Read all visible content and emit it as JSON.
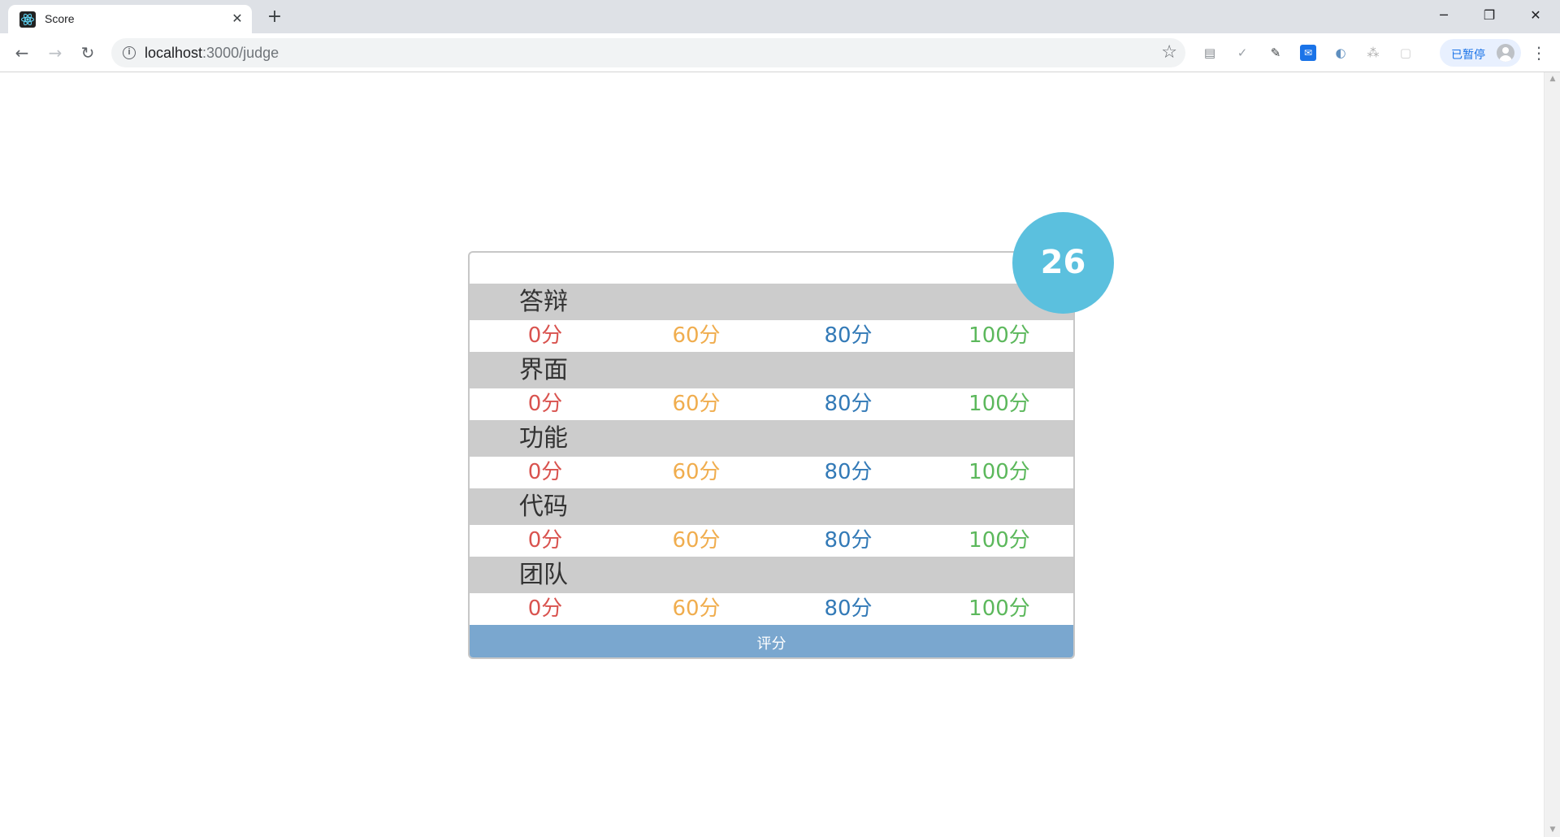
{
  "browser": {
    "tab_title": "Score",
    "url_host": "localhost",
    "url_path": ":3000/judge",
    "paused_label": "已暂停"
  },
  "colors": {
    "score_0": "#d9534f",
    "score_60": "#f0ad4e",
    "score_80": "#337ab7",
    "score_100": "#5cb85c",
    "badge": "#5bc0de",
    "submit": "#7aa7cf"
  },
  "card": {
    "total_score": "26",
    "categories": [
      {
        "name": "答辩",
        "options": [
          "0分",
          "60分",
          "80分",
          "100分"
        ]
      },
      {
        "name": "界面",
        "options": [
          "0分",
          "60分",
          "80分",
          "100分"
        ]
      },
      {
        "name": "功能",
        "options": [
          "0分",
          "60分",
          "80分",
          "100分"
        ]
      },
      {
        "name": "代码",
        "options": [
          "0分",
          "60分",
          "80分",
          "100分"
        ]
      },
      {
        "name": "团队",
        "options": [
          "0分",
          "60分",
          "80分",
          "100分"
        ]
      }
    ],
    "submit_label": "评分"
  }
}
